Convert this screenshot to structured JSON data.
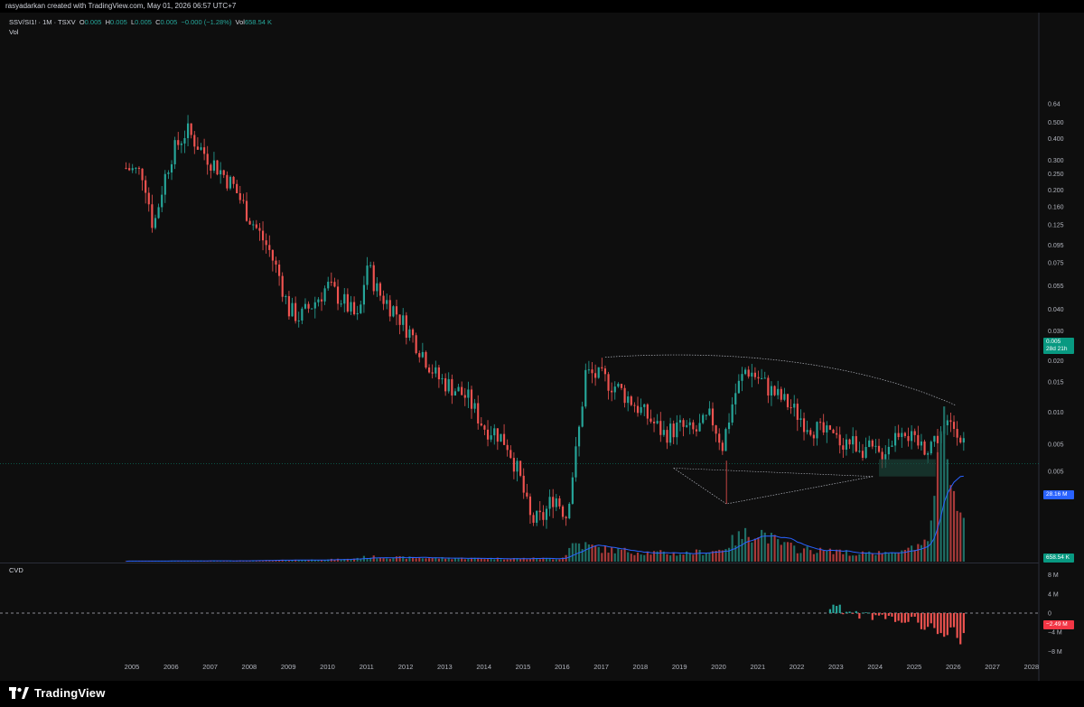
{
  "header": {
    "credit": "rasyadarkan created with TradingView.com, May 01, 2026 06:57 UTC+7"
  },
  "legend": {
    "symbol": "SSV/SI1! · 1M · TSXV",
    "o_label": "O",
    "o_value": "0.005",
    "h_label": "H",
    "h_value": "0.005",
    "l_label": "L",
    "l_value": "0.005",
    "c_label": "C",
    "c_value": "0.005",
    "change": "−0.000 (−1.28%)",
    "vol_label": "Vol",
    "vol_value": "658.54 K",
    "vol_pane": "Vol",
    "cvd_pane": "CVD"
  },
  "badges": {
    "price": "0.005",
    "countdown": "28d 21h",
    "vol_ma": "28.16 M",
    "vol": "658.54 K",
    "cvd": "−2.49 M"
  },
  "brand": {
    "name": "TradingView",
    "icon": "tradingview-logo-icon"
  },
  "colors": {
    "up": "#26a69a",
    "down": "#ef5350",
    "ma": "#2962ff",
    "bg": "#0e0e0e"
  },
  "chart_data": {
    "type": "candlestick",
    "y_scale": "log",
    "y_ticks": [
      "0.64",
      "0.500",
      "0.400",
      "0.300",
      "0.250",
      "0.200",
      "0.160",
      "0.125",
      "0.095",
      "0.075",
      "0.055",
      "0.040",
      "0.030",
      "0.020",
      "0.015",
      "0.010",
      "0.005",
      "0.005"
    ],
    "y_tick_values": [
      0.64,
      0.5,
      0.4,
      0.3,
      0.25,
      0.2,
      0.16,
      0.125,
      0.095,
      0.075,
      0.055,
      0.04,
      0.03,
      0.02,
      0.015,
      0.01,
      0.0065,
      0.0045
    ],
    "x_ticks": [
      "2005",
      "2006",
      "2007",
      "2008",
      "2009",
      "2010",
      "2011",
      "2012",
      "2013",
      "2014",
      "2015",
      "2016",
      "2017",
      "2018",
      "2019",
      "2020",
      "2021",
      "2022",
      "2023",
      "2024",
      "2025",
      "2026",
      "2027",
      "2028"
    ],
    "price_anchors": {
      "x": [
        2004.85,
        2005.3,
        2005.55,
        2005.8,
        2006.0,
        2006.4,
        2006.8,
        2007.2,
        2007.6,
        2008.0,
        2008.5,
        2008.8,
        2009.0,
        2009.3,
        2009.7,
        2010.0,
        2010.4,
        2010.8,
        2011.0,
        2011.3,
        2011.7,
        2012.0,
        2012.4,
        2012.8,
        2013.2,
        2013.6,
        2014.0,
        2014.3,
        2014.6,
        2014.9,
        2015.2,
        2015.5,
        2015.8,
        2016.1,
        2016.4,
        2016.6,
        2017.0,
        2017.4,
        2017.8,
        2018.2,
        2018.6,
        2019.0,
        2019.4,
        2019.8,
        2020.1,
        2020.4,
        2020.7,
        2021.0,
        2021.4,
        2021.8,
        2022.2,
        2022.6,
        2023.0,
        2023.4,
        2023.8,
        2024.1,
        2024.4,
        2024.7,
        2025.0,
        2025.3,
        2025.6,
        2025.9,
        2026.1,
        2026.3
      ],
      "y": [
        0.27,
        0.25,
        0.12,
        0.22,
        0.32,
        0.45,
        0.34,
        0.27,
        0.21,
        0.14,
        0.09,
        0.06,
        0.04,
        0.036,
        0.045,
        0.055,
        0.045,
        0.034,
        0.075,
        0.05,
        0.04,
        0.032,
        0.023,
        0.016,
        0.014,
        0.012,
        0.0082,
        0.0077,
        0.0065,
        0.0043,
        0.0023,
        0.0024,
        0.0033,
        0.0025,
        0.0068,
        0.017,
        0.016,
        0.014,
        0.0115,
        0.0093,
        0.0075,
        0.0082,
        0.0076,
        0.0095,
        0.0064,
        0.0125,
        0.018,
        0.016,
        0.013,
        0.011,
        0.0088,
        0.0077,
        0.0069,
        0.0067,
        0.0061,
        0.0056,
        0.0067,
        0.0085,
        0.0065,
        0.0063,
        0.0072,
        0.0085,
        0.0082,
        0.0065
      ]
    },
    "volume_anchors": {
      "x": [
        2004.85,
        2008,
        2010.5,
        2011,
        2012,
        2014,
        2016,
        2016.3,
        2017,
        2018,
        2019,
        2020,
        2020.5,
        2021,
        2021.5,
        2022,
        2023,
        2024,
        2024.5,
        2025,
        2025.4,
        2025.6,
        2025.8,
        2026.0,
        2026.2,
        2026.3
      ],
      "y": [
        0.3,
        0.6,
        1.5,
        3,
        2.5,
        2,
        2,
        12,
        8,
        6,
        5,
        7,
        15,
        20,
        12,
        8,
        6,
        5,
        8,
        9,
        12,
        70,
        85,
        60,
        35,
        20
      ]
    },
    "cvd_anchors": {
      "x": [
        2022.8,
        2023.2,
        2023.6,
        2024.0,
        2024.4,
        2024.8,
        2025.2,
        2025.6,
        2025.8,
        2026.0,
        2026.2,
        2026.3
      ],
      "y": [
        1.5,
        0.5,
        -0.5,
        -1,
        -1.5,
        -1,
        -2.5,
        -3.5,
        -5,
        -3,
        -8,
        -2.49
      ]
    },
    "volume_ma_label": "28.16 M",
    "cvd_ticks": [
      "8 M",
      "4 M",
      "0",
      "−4 M",
      "−8 M"
    ],
    "cvd_tick_values": [
      8,
      4,
      0,
      -4,
      -8
    ],
    "last_price": 0.005,
    "last_volume": "658.54 K",
    "last_cvd": "−2.49 M"
  }
}
